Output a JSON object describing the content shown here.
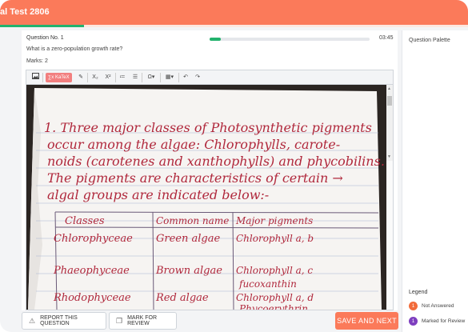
{
  "header": {
    "title": "al Test 2806",
    "progress_fraction": 0.18
  },
  "question": {
    "number_label": "Question No. 1",
    "timer": "03:45",
    "timer_fraction": 0.07,
    "text": "What is a zero-population growth rate?",
    "marks": "Marks: 2"
  },
  "toolbar": {
    "katex_label": "∑x KaTeX",
    "icons": [
      "image-icon",
      "pen-icon",
      "subscript-icon",
      "superscript-icon",
      "ordered-list-icon",
      "unordered-list-icon",
      "omega-icon",
      "table-icon",
      "undo-icon",
      "redo-icon"
    ]
  },
  "handwriting": {
    "lines": [
      "1. Three major classes of Photosynthetic pigments",
      "occur among the algae: Chlorophylls, carote-",
      "noids (carotenes and xanthophylls) and phycobilins.",
      "The pigments are characteristics of certain →",
      "algal groups are indicated below:-"
    ],
    "table_headers": [
      "Classes",
      "Common name",
      "Major pigments"
    ],
    "table_rows": [
      [
        "Chlorophyceae",
        "Green algae",
        "Chlorophyll a, b"
      ],
      [
        "Phaeophyceae",
        "Brown algae",
        "Chlorophyll a, c",
        "fucoxanthin"
      ],
      [
        "Rhodophyceae",
        "Red algae",
        "Chlorophyll a, d",
        "Phycoerythrin"
      ]
    ]
  },
  "footer": {
    "report_label": "REPORT THIS QUESTION",
    "review_label": "MARK FOR REVIEW",
    "next_label": "SAVE AND NEXT"
  },
  "palette": {
    "title": "Question Palette",
    "legend_title": "Legend",
    "legend": [
      {
        "count": "1",
        "label": "Not Answered",
        "color": "#f26b3a"
      },
      {
        "count": "1",
        "label": "Marked for Review",
        "color": "#7e3fbf"
      }
    ]
  }
}
